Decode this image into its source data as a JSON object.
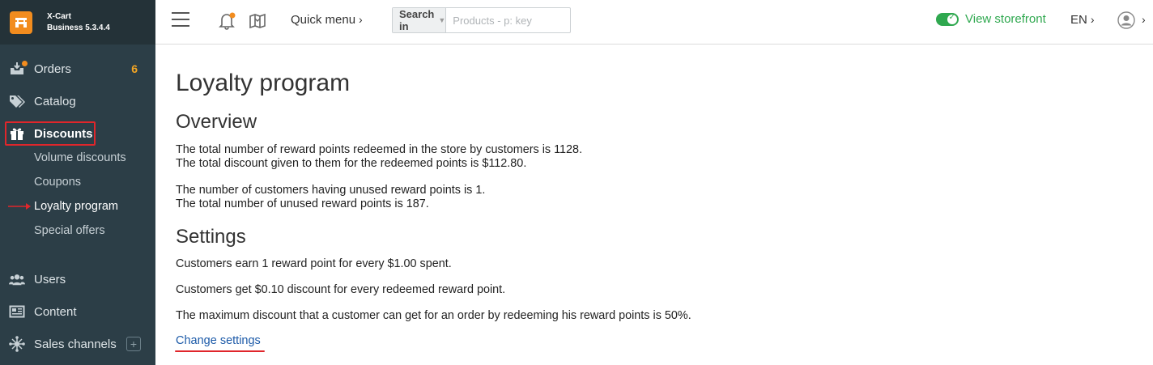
{
  "brand": {
    "line1": "X-Cart",
    "line2": "Business 5.3.4.4",
    "logo_color": "#f28c1e"
  },
  "sidebar": {
    "items": [
      {
        "label": "Orders",
        "icon": "inbox-icon",
        "badge": "6"
      },
      {
        "label": "Catalog",
        "icon": "tags-icon"
      },
      {
        "label": "Discounts",
        "icon": "gift-icon"
      },
      {
        "label": "Volume discounts"
      },
      {
        "label": "Coupons"
      },
      {
        "label": "Loyalty program"
      },
      {
        "label": "Special offers"
      },
      {
        "label": "Users",
        "icon": "users-icon"
      },
      {
        "label": "Content",
        "icon": "newspaper-icon"
      },
      {
        "label": "Sales channels",
        "icon": "network-icon"
      }
    ],
    "colors": {
      "bg": "#2c3e47",
      "highlight": "#e0262b"
    }
  },
  "header": {
    "quick_menu": "Quick menu",
    "search": {
      "select_label": "Search in",
      "placeholder": "Products - p: key"
    },
    "storefront": "View storefront",
    "language": "EN"
  },
  "main": {
    "title": "Loyalty program",
    "overview": {
      "heading": "Overview",
      "lines": [
        "The total number of reward points redeemed in the store by customers is 1128.",
        "The total discount given to them for the redeemed points is $112.80.",
        "The number of customers having unused reward points is 1.",
        "The total number of unused reward points is 187."
      ]
    },
    "settings": {
      "heading": "Settings",
      "lines": [
        "Customers earn 1 reward point for every $1.00 spent.",
        "Customers get $0.10 discount for every redeemed reward point.",
        "The maximum discount that a customer can get for an order by redeeming his reward points is 50%."
      ],
      "link": "Change settings"
    }
  }
}
